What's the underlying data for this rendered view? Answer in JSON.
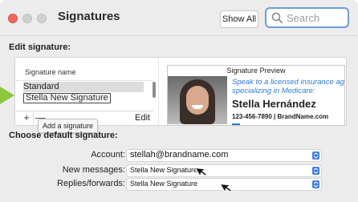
{
  "window": {
    "title": "Signatures",
    "show_all_label": "Show All",
    "search_placeholder": "Search"
  },
  "edit_section": {
    "heading": "Edit signature:",
    "list_header": "Signature name",
    "items": [
      {
        "label": "Standard",
        "selected": true
      },
      {
        "label": "Stella New Signature",
        "editing": true
      }
    ],
    "plus_label": "+",
    "minus_label": "—",
    "edit_label": "Edit",
    "tooltip": "Add a signature"
  },
  "preview": {
    "title": "Signature Preview",
    "tagline_1": "Speak to a licensed insurance ag",
    "tagline_2": "specializing in Medicare:",
    "name": "Stella Hernández",
    "contact": "123-456-7890  |  BrandName.com"
  },
  "default_section": {
    "heading": "Choose default signature:",
    "account_label": "Account:",
    "account_value": "stellah@brandname.com",
    "new_messages_label": "New messages:",
    "new_messages_value": "Stella New Signature",
    "replies_label": "Replies/forwards:",
    "replies_value": "Stella New Signature"
  },
  "colors": {
    "accent": "#3e7ee0",
    "indicator": "#8dc63f",
    "close_button": "#ee6a5e"
  }
}
